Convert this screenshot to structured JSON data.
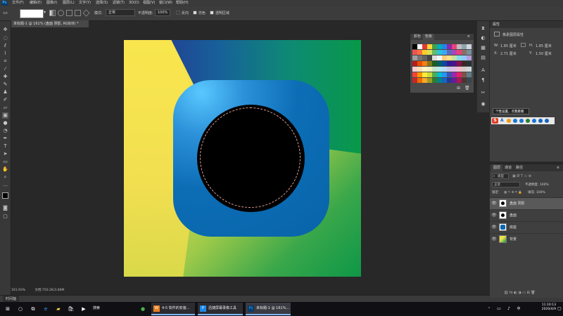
{
  "menubar": {
    "logo": "Ps",
    "items": [
      "文件(F)",
      "编辑(E)",
      "图像(I)",
      "图层(L)",
      "文字(Y)",
      "选择(S)",
      "滤镜(T)",
      "3D(D)",
      "视图(V)",
      "窗口(W)",
      "帮助(H)"
    ]
  },
  "options": {
    "mode_label": "模式:",
    "mode_value": "正常",
    "opacity_label": "不透明度:",
    "opacity_value": "100%",
    "reverse_label": "反向",
    "dither_label": "仿色",
    "transparency_label": "透明区域"
  },
  "document": {
    "tab_title": "未标题-1 @ 161% (盘面 阴影, RGB/8) *",
    "zoom": "161.93%",
    "doc_size": "文档:750.2K/3.66M"
  },
  "timeline": {
    "tab": "时间轴"
  },
  "swatches": {
    "tab1": "颜色",
    "tab2": "色板"
  },
  "properties": {
    "title": "属性",
    "subtitle": "像素图层属性",
    "w_label": "W:",
    "w_value": "1.85 厘米",
    "h_label": "H:",
    "h_value": "1.85 厘米",
    "x_label": "X:",
    "x_value": "2.71 厘米",
    "y_label": "Y:",
    "y_value": "1.50 厘米"
  },
  "tooltip": "个性设置，点我看看",
  "layers": {
    "tab1": "图层",
    "tab2": "通道",
    "tab3": "路径",
    "kind": "类型",
    "blend": "正常",
    "opacity": "不透明度: 100%",
    "lock": "锁定:",
    "fill": "填充: 100%",
    "items": [
      {
        "name": "盘面 阴影",
        "thumb": "black-circle",
        "selected": true
      },
      {
        "name": "盘面",
        "thumb": "black-circle",
        "selected": false
      },
      {
        "name": "底座",
        "thumb": "blue",
        "selected": false
      },
      {
        "name": "背景",
        "thumb": "gradient",
        "selected": false
      }
    ]
  },
  "taskbar": {
    "apps": [
      {
        "icon": "W",
        "label": "4-5 软件的安装..."
      },
      {
        "icon": "P",
        "label": "迅捷屏幕录像工具"
      },
      {
        "icon": "Ps",
        "label": "未标题-1 @ 161%..."
      }
    ],
    "search_label": "搜索",
    "time": "11:10:13",
    "date": "2020/4/9"
  },
  "colors": {
    "canvas_yellow": "#f6e44a",
    "canvas_green": "#0e9748",
    "navy": "#2a2c8e",
    "rounded_blue": "#0864a9",
    "highlight_blue": "#59c8ff",
    "hole": "#000000"
  }
}
